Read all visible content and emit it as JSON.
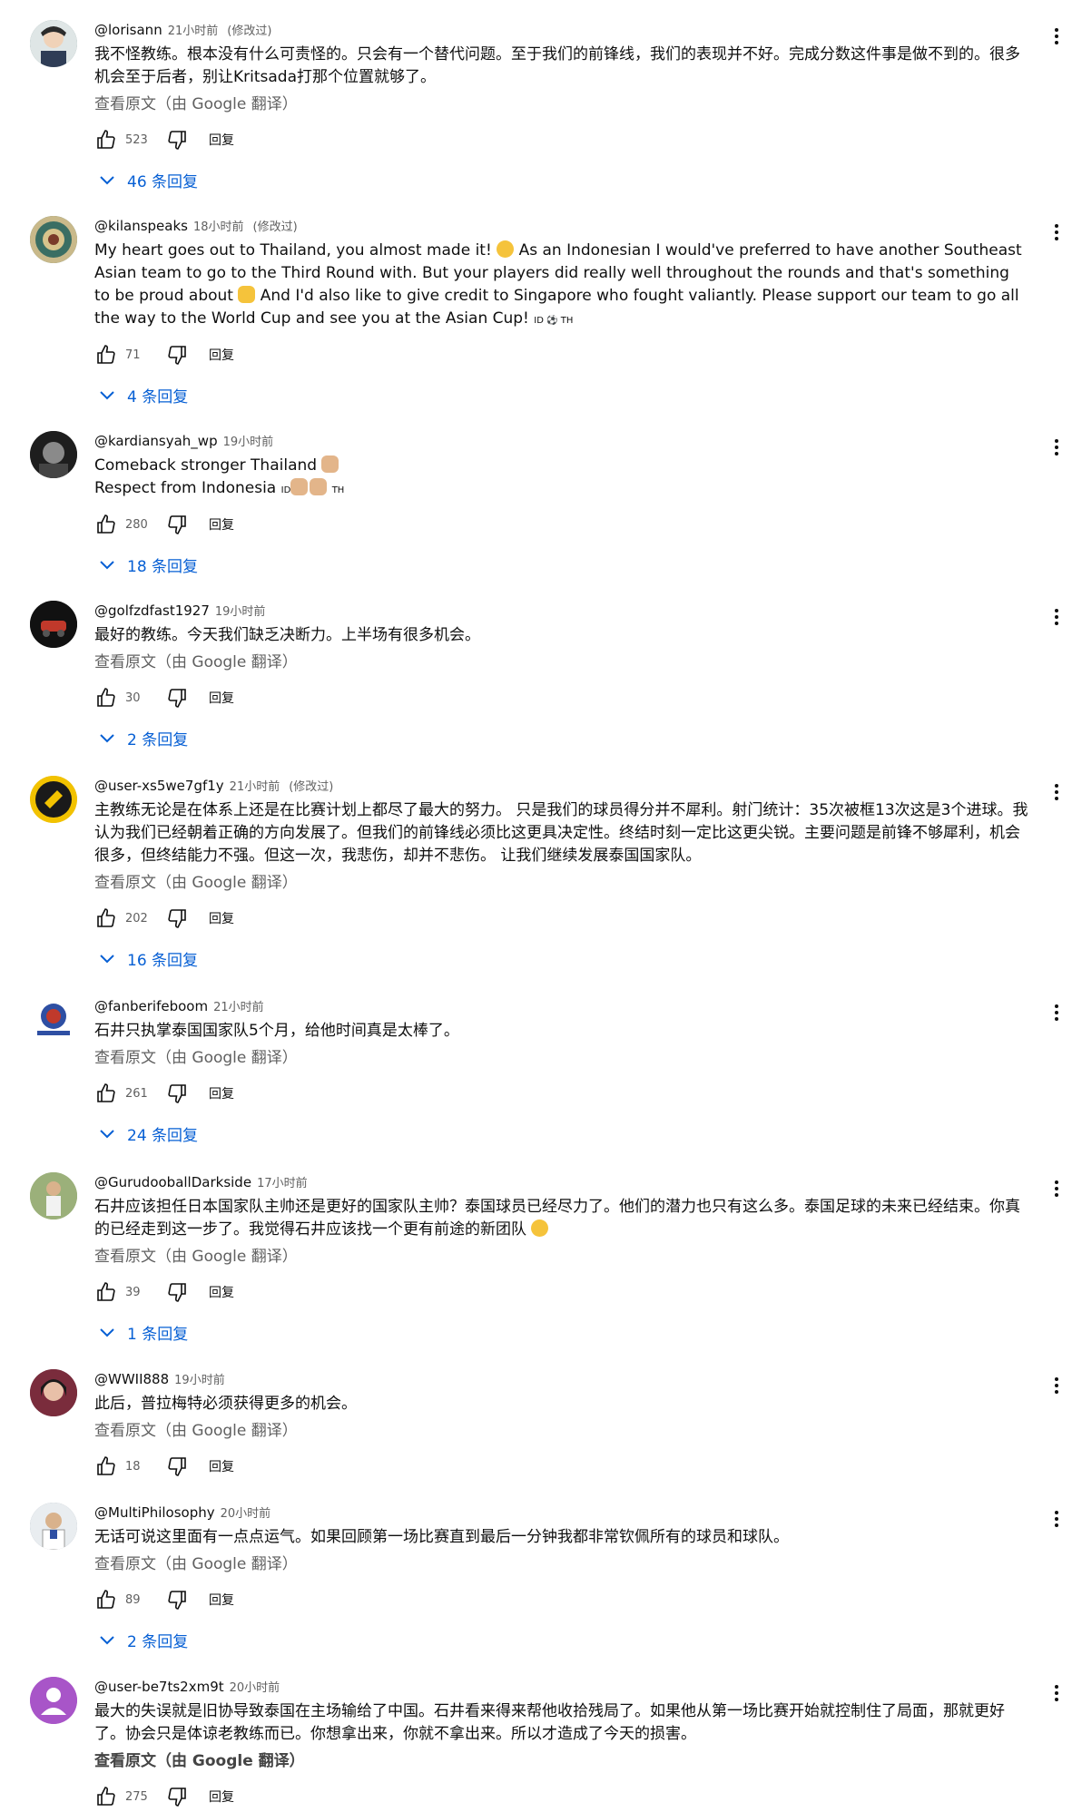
{
  "comments": [
    {
      "author": "@lorisann",
      "time": "21小时前",
      "edited": "(修改过)",
      "text": "我不怪教练。根本没有什么可责怪的。只会有一个替代问题。至于我们的前锋线，我们的表现并不好。完成分数这件事是做不到的。很多机会至于后者，别让Kritsada打那个位置就够了。",
      "translate": "查看原文（由 Google 翻译）",
      "likes": "523",
      "reply": "回复",
      "replies": "46 条回复",
      "avatar_color": "#5c7a7a"
    },
    {
      "author": "@kilanspeaks",
      "time": "18小时前",
      "edited": "(修改过)",
      "text_a": "My heart goes out to Thailand, you almost made it!",
      "text_b": "As an Indonesian I would've preferred to have another Southeast Asian team to go to the Third Round with. But your players did really well throughout the rounds and that's something to be proud about",
      "text_c": "And I'd also like to give credit to Singapore who fought valiantly. Please support our team to go all the way to the World Cup and see you at the Asian Cup!",
      "flags": "ID ⚽ TH",
      "likes": "71",
      "reply": "回复",
      "replies": "4 条回复",
      "avatar_color": "#3f6b5a"
    },
    {
      "author": "@kardiansyah_wp",
      "time": "19小时前",
      "text_line1": "Comeback stronger Thailand",
      "text_line2": "Respect from Indonesia",
      "flags_a": "ID",
      "flags_b": "TH",
      "likes": "280",
      "reply": "回复",
      "replies": "18 条回复",
      "avatar_color": "#2a2a2a"
    },
    {
      "author": "@golfzdfast1927",
      "time": "19小时前",
      "text": "最好的教练。今天我们缺乏决断力。上半场有很多机会。",
      "translate": "查看原文（由 Google 翻译）",
      "likes": "30",
      "reply": "回复",
      "replies": "2 条回复",
      "avatar_color": "#1a1a1a"
    },
    {
      "author": "@user-xs5we7gf1y",
      "time": "21小时前",
      "edited": "(修改过)",
      "text": "主教练无论是在体系上还是在比赛计划上都尽了最大的努力。 只是我们的球员得分并不犀利。射门统计：35次被框13次这是3个进球。我认为我们已经朝着正确的方向发展了。但我们的前锋线必须比这更具决定性。终结时刻一定比这更尖锐。主要问题是前锋不够犀利，机会很多，但终结能力不强。但这一次，我悲伤，却并不悲伤。 让我们继续发展泰国国家队。",
      "translate": "查看原文（由 Google 翻译）",
      "likes": "202",
      "reply": "回复",
      "replies": "16 条回复",
      "avatar_color": "#e6b800"
    },
    {
      "author": "@fanberifeboom",
      "time": "21小时前",
      "text": "石井只执掌泰国国家队5个月，给他时间真是太棒了。",
      "translate": "查看原文（由 Google 翻译）",
      "likes": "261",
      "reply": "回复",
      "replies": "24 条回复",
      "avatar_color": "#c0392b"
    },
    {
      "author": "@GurudooballDarkside",
      "time": "17小时前",
      "text": "石井应该担任日本国家队主帅还是更好的国家队主帅？泰国球员已经尽力了。他们的潜力也只有这么多。泰国足球的未来已经结束。你真的已经走到这一步了。我觉得石井应该找一个更有前途的新团队",
      "translate": "查看原文（由 Google 翻译）",
      "likes": "39",
      "reply": "回复",
      "replies": "1 条回复",
      "avatar_color": "#8aa36b"
    },
    {
      "author": "@WWII888",
      "time": "19小时前",
      "text": "此后，普拉梅特必须获得更多的机会。",
      "translate": "查看原文（由 Google 翻译）",
      "likes": "18",
      "reply": "回复",
      "avatar_color": "#6b3b4b"
    },
    {
      "author": "@MultiPhilosophy",
      "time": "20小时前",
      "text": "无话可说这里面有一点点运气。如果回顾第一场比赛直到最后一分钟我都非常钦佩所有的球员和球队。",
      "translate": "查看原文（由 Google 翻译）",
      "likes": "89",
      "reply": "回复",
      "replies": "2 条回复",
      "avatar_color": "#7d8b99"
    },
    {
      "author": "@user-be7ts2xm9t",
      "time": "20小时前",
      "text": "最大的失误就是旧协导致泰国在主场输给了中国。石井看来得来帮他收拾残局了。如果他从第一场比赛开始就控制住了局面，那就更好了。协会只是体谅老教练而已。你想拿出来，你就不拿出来。所以才造成了今天的损害。",
      "translate": "查看原文（由 Google 翻译）",
      "likes": "275",
      "reply": "回复",
      "avatar_color": "#a855c8"
    }
  ]
}
